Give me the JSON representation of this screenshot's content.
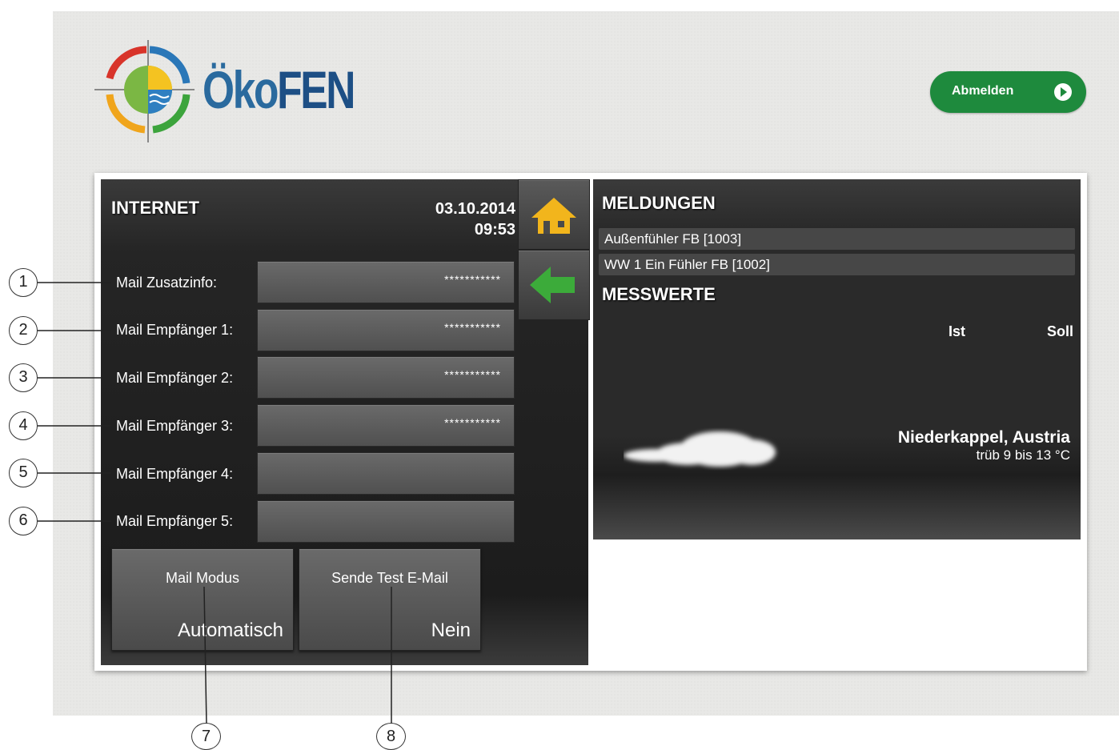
{
  "header": {
    "logo_text_a": "Öko",
    "logo_text_b": "FEN",
    "logout_label": "Abmelden"
  },
  "internet": {
    "title": "INTERNET",
    "date": "03.10.2014",
    "time": "09:53",
    "rows": [
      {
        "label": "Mail Zusatzinfo:",
        "value": "***********"
      },
      {
        "label": "Mail Empfänger 1:",
        "value": "***********"
      },
      {
        "label": "Mail Empfänger 2:",
        "value": "***********"
      },
      {
        "label": "Mail Empfänger 3:",
        "value": "***********"
      },
      {
        "label": "Mail Empfänger 4:",
        "value": ""
      },
      {
        "label": "Mail Empfänger 5:",
        "value": ""
      }
    ],
    "mail_mode": {
      "label": "Mail Modus",
      "value": "Automatisch"
    },
    "send_test": {
      "label": "Sende Test E-Mail",
      "value": "Nein"
    }
  },
  "messages": {
    "title": "MELDUNGEN",
    "items": [
      "Außenfühler FB [1003]",
      "WW 1 Ein Fühler FB [1002]"
    ]
  },
  "measurements": {
    "title": "MESSWERTE",
    "col_actual": "Ist",
    "col_target": "Soll"
  },
  "weather": {
    "location": "Niederkappel, Austria",
    "description": "trüb 9 bis 13 °C",
    "icon": "cloud-icon"
  },
  "callouts": [
    "1",
    "2",
    "3",
    "4",
    "5",
    "6",
    "7",
    "8"
  ],
  "colors": {
    "logout_green": "#1e8a3d",
    "home_yellow": "#f2b51c",
    "back_green": "#3cab3a"
  }
}
